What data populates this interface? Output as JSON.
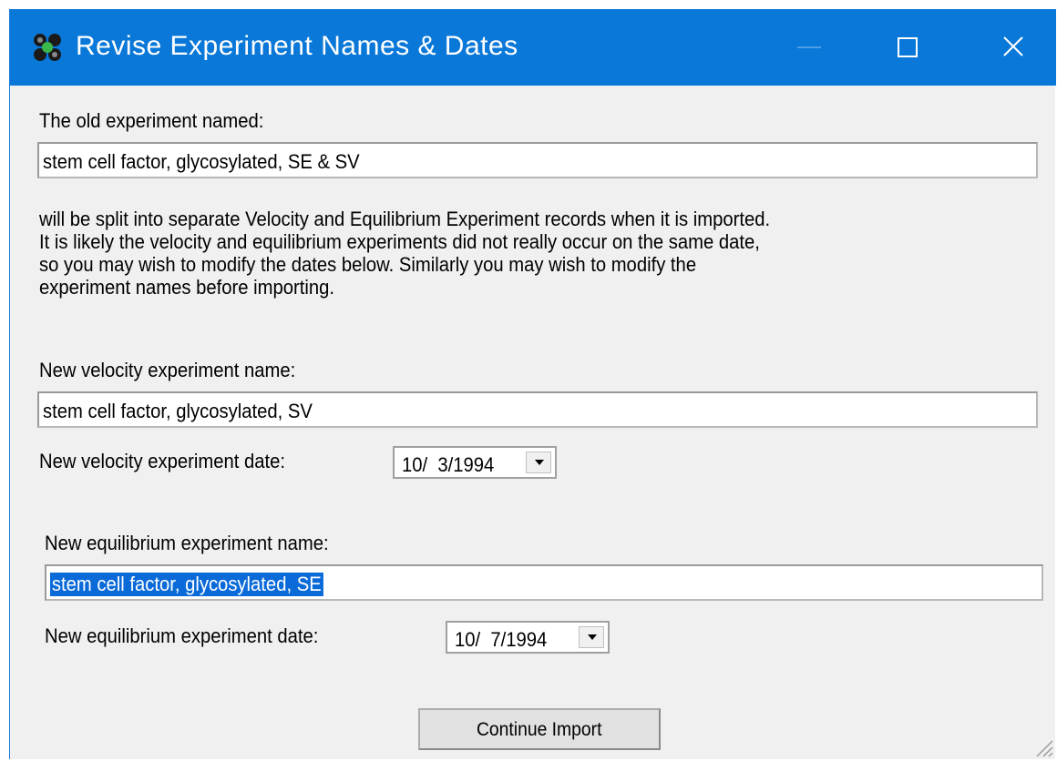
{
  "window": {
    "title": "Revise Experiment Names & Dates",
    "titlebar_color": "#0a78d8",
    "icons": [
      "app-icon",
      "minimize-icon",
      "maximize-icon",
      "close-icon"
    ]
  },
  "old_experiment": {
    "label": "The old experiment named:",
    "value": "stem cell factor, glycosylated, SE & SV"
  },
  "description": {
    "lines": [
      "will be split into separate Velocity and Equilibrium Experiment records when it is imported.",
      "It is likely the velocity and equilibrium experiments did not really occur on the same date,",
      "so you may wish to modify the dates below. Similarly you may wish to modify the",
      "experiment names before importing."
    ]
  },
  "velocity": {
    "name_label": "New velocity experiment name:",
    "name_value": "stem cell factor, glycosylated, SV",
    "date_label": "New velocity experiment date:",
    "date_value": "10/  3/1994"
  },
  "equilibrium": {
    "name_label": "New equilibrium experiment name:",
    "name_value": "stem cell factor, glycosylated, SE",
    "name_selected": true,
    "date_label": "New equilibrium experiment date:",
    "date_value": "10/  7/1994"
  },
  "continue_button": {
    "label": "Continue Import"
  },
  "colors": {
    "selection": "#0a6ad8",
    "dialog_bg": "#f0f0f0"
  }
}
